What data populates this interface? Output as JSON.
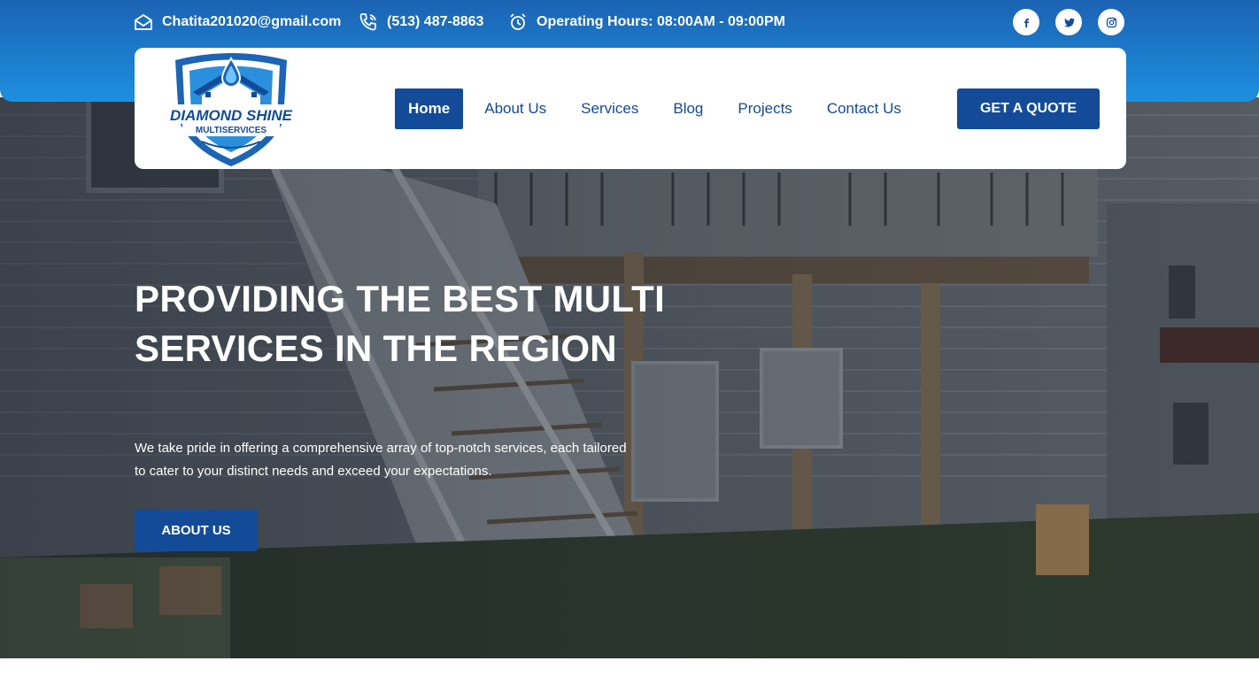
{
  "topbar": {
    "email": "Chatita201020@gmail.com",
    "phone": "(513) 487-8863",
    "hours": "Operating Hours: 08:00AM - 09:00PM",
    "social": [
      "facebook-icon",
      "twitter-icon",
      "instagram-icon"
    ]
  },
  "logo": {
    "line1": "DIAMOND SHINE",
    "line2": "MULTISERVICES"
  },
  "nav": {
    "items": [
      "Home",
      "About Us",
      "Services",
      "Blog",
      "Projects",
      "Contact Us"
    ],
    "active": "Home",
    "cta": "GET A QUOTE"
  },
  "hero": {
    "title": "PROVIDING THE BEST MULTI SERVICES IN THE REGION",
    "text": "We take pride in offering a comprehensive array of top-notch services, each tailored to cater to your distinct needs and exceed your expectations.",
    "button": "ABOUT US"
  },
  "colors": {
    "brand": "#134b98",
    "topbar_start": "#1c63b3",
    "topbar_end": "#1d8fe0"
  }
}
